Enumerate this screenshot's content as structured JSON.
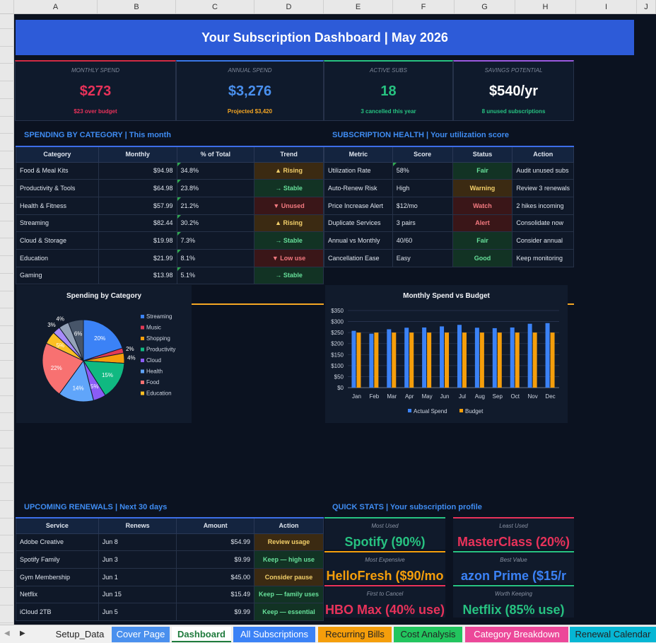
{
  "columns": [
    "A",
    "B",
    "C",
    "D",
    "E",
    "F",
    "G",
    "H",
    "I",
    "J"
  ],
  "banner": "Your Subscription Dashboard  |  May 2026",
  "kpis": [
    {
      "label": "MONTHLY SPEND",
      "value": "$273",
      "sub": "$23 over budget",
      "color": "#e8325a",
      "sub_color": "#e8325a",
      "top": "#d12b45"
    },
    {
      "label": "ANNUAL SPEND",
      "value": "$3,276",
      "sub": "Projected $3,420",
      "color": "#4a90ee",
      "sub_color": "#f5a623",
      "top": "#3a78e8"
    },
    {
      "label": "ACTIVE SUBS",
      "value": "18",
      "sub": "3 cancelled this year",
      "color": "#27c281",
      "sub_color": "#27c281",
      "top": "#27c281"
    },
    {
      "label": "SAVINGS POTENTIAL",
      "value": "$540/yr",
      "sub": "8 unused subscriptions",
      "color": "#ffffff",
      "sub_color": "#27c281",
      "top": "#9b59e0"
    }
  ],
  "category": {
    "title": "SPENDING BY CATEGORY  |  This month",
    "headers": [
      "Category",
      "Monthly",
      "% of Total",
      "Trend"
    ],
    "rows": [
      {
        "name": "Food & Meal Kits",
        "monthly": "$94.98",
        "pct": "34.8%",
        "trend": "▲ Rising",
        "tone": "amber"
      },
      {
        "name": "Productivity & Tools",
        "monthly": "$64.98",
        "pct": "23.8%",
        "trend": "→ Stable",
        "tone": "green"
      },
      {
        "name": "Health & Fitness",
        "monthly": "$57.99",
        "pct": "21.2%",
        "trend": "▼ Unused",
        "tone": "red"
      },
      {
        "name": "Streaming",
        "monthly": "$82.44",
        "pct": "30.2%",
        "trend": "▲ Rising",
        "tone": "amber"
      },
      {
        "name": "Cloud & Storage",
        "monthly": "$19.98",
        "pct": "7.3%",
        "trend": "→ Stable",
        "tone": "green"
      },
      {
        "name": "Education",
        "monthly": "$21.99",
        "pct": "8.1%",
        "trend": "▼ Low use",
        "tone": "red"
      },
      {
        "name": "Gaming",
        "monthly": "$13.98",
        "pct": "5.1%",
        "trend": "→ Stable",
        "tone": "green"
      }
    ]
  },
  "health": {
    "title": "SUBSCRIPTION HEALTH  |  Your utilization score",
    "headers": [
      "Metric",
      "Score",
      "Status",
      "Action"
    ],
    "rows": [
      {
        "metric": "Utilization Rate",
        "score": "58%",
        "status": "Fair",
        "tone": "green",
        "action": "Audit unused subs"
      },
      {
        "metric": "Auto-Renew Risk",
        "score": "High",
        "status": "Warning",
        "tone": "amber",
        "action": "Review 3 renewals"
      },
      {
        "metric": "Price Increase Alert",
        "score": "$12/mo",
        "status": "Watch",
        "tone": "red",
        "action": "2 hikes incoming"
      },
      {
        "metric": "Duplicate Services",
        "score": "3 pairs",
        "status": "Alert",
        "tone": "red",
        "action": "Consolidate now"
      },
      {
        "metric": "Annual vs Monthly",
        "score": "40/60",
        "status": "Fair",
        "tone": "green",
        "action": "Consider annual"
      },
      {
        "metric": "Cancellation Ease",
        "score": "Easy",
        "status": "Good",
        "tone": "green",
        "action": "Keep monitoring"
      }
    ]
  },
  "chart_data": [
    {
      "type": "pie",
      "title": "Spending by Category",
      "categories": [
        "Streaming",
        "Music",
        "Shopping",
        "Productivity",
        "Cloud",
        "Health",
        "Food",
        "Education"
      ],
      "values": [
        20,
        2,
        4,
        15,
        5,
        14,
        22,
        5
      ],
      "extra_slices": [
        {
          "value": 3
        },
        {
          "value": 4
        },
        {
          "value": 6
        }
      ],
      "colors": [
        "#3b82f6",
        "#e23a55",
        "#f59e0b",
        "#10b981",
        "#8b5cf6",
        "#60a5fa",
        "#f87171",
        "#fbbf24"
      ],
      "extra_colors": [
        "#a78bfa",
        "#94a3b8",
        "#475569"
      ]
    },
    {
      "type": "bar",
      "title": "Monthly Spend vs Budget",
      "categories": [
        "Jan",
        "Feb",
        "Mar",
        "Apr",
        "May",
        "Jun",
        "Jul",
        "Aug",
        "Sep",
        "Oct",
        "Nov",
        "Dec"
      ],
      "series": [
        {
          "name": "Actual Spend",
          "values": [
            258,
            245,
            265,
            272,
            273,
            278,
            285,
            272,
            270,
            273,
            290,
            293
          ],
          "color": "#3b82f6"
        },
        {
          "name": "Budget",
          "values": [
            250,
            250,
            250,
            250,
            250,
            250,
            250,
            250,
            250,
            250,
            250,
            250
          ],
          "color": "#f59e0b"
        }
      ],
      "ylim": [
        0,
        350
      ],
      "yticks": [
        "$0",
        "$50",
        "$100",
        "$150",
        "$200",
        "$250",
        "$300",
        "$350"
      ],
      "legend": "bottom"
    }
  ],
  "renewals": {
    "title": "UPCOMING RENEWALS  |  Next 30 days",
    "headers": [
      "Service",
      "Renews",
      "Amount",
      "Action"
    ],
    "rows": [
      {
        "service": "Adobe Creative",
        "renews": "Jun 8",
        "amount": "$54.99",
        "action": "Review usage",
        "tone": "amber"
      },
      {
        "service": "Spotify Family",
        "renews": "Jun 3",
        "amount": "$9.99",
        "action": "Keep — high use",
        "tone": "green"
      },
      {
        "service": "Gym Membership",
        "renews": "Jun 1",
        "amount": "$45.00",
        "action": "Consider pause",
        "tone": "amber"
      },
      {
        "service": "Netflix",
        "renews": "Jun 15",
        "amount": "$15.49",
        "action": "Keep — family uses",
        "tone": "green"
      },
      {
        "service": "iCloud 2TB",
        "renews": "Jun 5",
        "amount": "$9.99",
        "action": "Keep — essential",
        "tone": "green"
      }
    ]
  },
  "quick_stats": {
    "title": "QUICK STATS  |  Your subscription profile",
    "cells": [
      {
        "label": "Most Used",
        "value": "Spotify (90%)",
        "color": "#27c281"
      },
      {
        "label": "Least Used",
        "value": "MasterClass (20%)",
        "color": "#e8325a"
      },
      {
        "label": "Most Expensive",
        "value": "HelloFresh ($90/mo",
        "color": "#f59e0b"
      },
      {
        "label": "Best Value",
        "value": "azon Prime ($15/r",
        "color": "#3b82f6"
      },
      {
        "label": "First to Cancel",
        "value": "HBO Max (40% use)",
        "color": "#e8325a"
      },
      {
        "label": "Worth Keeping",
        "value": "Netflix (85% use)",
        "color": "#27c281"
      }
    ]
  },
  "tabs": [
    {
      "label": "Setup_Data",
      "bg": "#f0f0f0",
      "fg": "#222"
    },
    {
      "label": "Cover Page",
      "bg": "#4a90ee",
      "fg": "#fff"
    },
    {
      "label": "Dashboard",
      "bg": "#ffffff",
      "fg": "#1e7a3c"
    },
    {
      "label": "All Subscriptions",
      "bg": "#3b82f6",
      "fg": "#fff"
    },
    {
      "label": "Recurring Bills",
      "bg": "#f59e0b",
      "fg": "#222"
    },
    {
      "label": "Cost Analysis",
      "bg": "#22c55e",
      "fg": "#222"
    },
    {
      "label": "Category Breakdown",
      "bg": "#ec4899",
      "fg": "#fff"
    },
    {
      "label": "Renewal Calendar",
      "bg": "#06b6d4",
      "fg": "#222"
    }
  ]
}
